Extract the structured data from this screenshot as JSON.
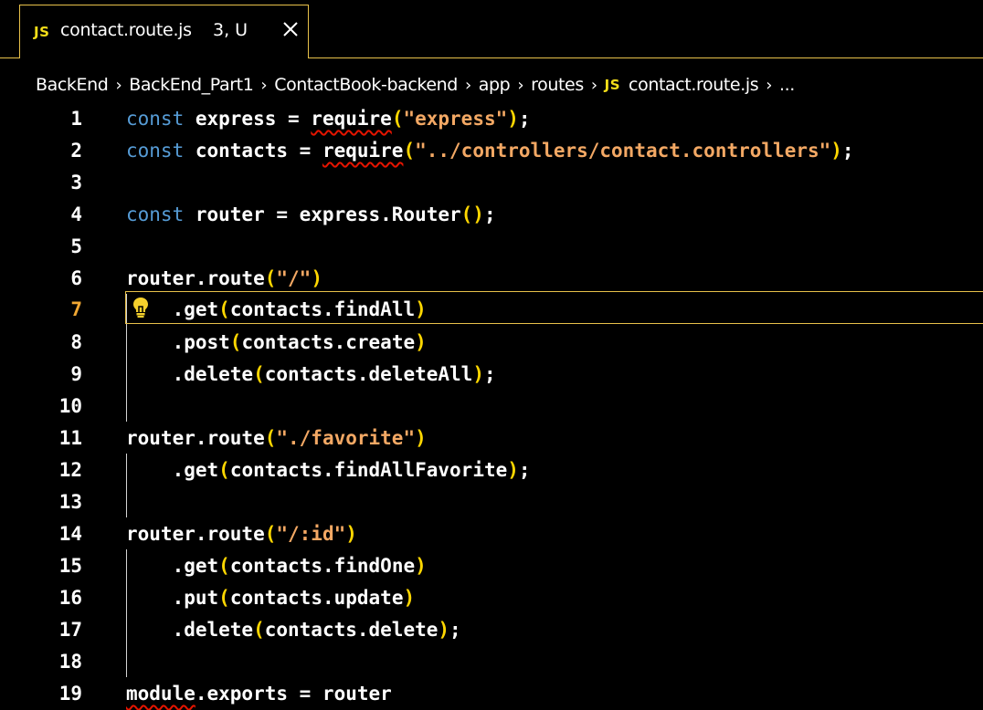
{
  "tab": {
    "badge_icon": "JS",
    "title": "contact.route.js",
    "status": "3, U",
    "close_icon": "close-icon"
  },
  "breadcrumb": {
    "items": [
      "BackEnd",
      "BackEnd_Part1",
      "ContactBook-backend",
      "app",
      "routes"
    ],
    "file_icon": "JS",
    "file": "contact.route.js",
    "ellipsis": "..."
  },
  "editor": {
    "active_line": 7,
    "lines": [
      {
        "n": "1"
      },
      {
        "n": "2"
      },
      {
        "n": "3"
      },
      {
        "n": "4"
      },
      {
        "n": "5"
      },
      {
        "n": "6"
      },
      {
        "n": "7"
      },
      {
        "n": "8"
      },
      {
        "n": "9"
      },
      {
        "n": "10"
      },
      {
        "n": "11"
      },
      {
        "n": "12"
      },
      {
        "n": "13"
      },
      {
        "n": "14"
      },
      {
        "n": "15"
      },
      {
        "n": "16"
      },
      {
        "n": "17"
      },
      {
        "n": "18"
      },
      {
        "n": "19"
      }
    ],
    "code": {
      "l1_kw": "const",
      "l1_rest": " express = ",
      "l1_fn": "require",
      "l1_str": "\"express\"",
      "l1_end": ";",
      "l2_kw": "const",
      "l2_rest": " contacts = ",
      "l2_fn": "require",
      "l2_str": "\"../controllers/contact.controllers\"",
      "l2_end": ";",
      "l4_kw": "const",
      "l4_rest": " router = express.Router",
      "l4_end": ";",
      "l6_head": "router.route",
      "l6_str": "\"/\"",
      "l7_head": "    .get",
      "l7_arg": "contacts.findAll",
      "l8_head": "    .post",
      "l8_arg": "contacts.create",
      "l9_head": "    .delete",
      "l9_arg": "contacts.deleteAll",
      "l9_end": ";",
      "l11_head": "router.route",
      "l11_str": "\"./favorite\"",
      "l12_head": "    .get",
      "l12_arg": "contacts.findAllFavorite",
      "l12_end": ";",
      "l14_head": "router.route",
      "l14_str": "\"/:id\"",
      "l15_head": "    .get",
      "l15_arg": "contacts.findOne",
      "l16_head": "    .put",
      "l16_arg": "contacts.update",
      "l17_head": "    .delete",
      "l17_arg": "contacts.delete",
      "l17_end": ";",
      "l19_a": "module",
      "l19_b": ".exports = router"
    }
  },
  "colors": {
    "background": "#000000",
    "keyword": "#569cd6",
    "string": "#f3a864",
    "bracket": "#ffd700",
    "js_badge": "#f5de19",
    "active_border": "#e8c14a",
    "error_squiggle": "#e51400"
  }
}
